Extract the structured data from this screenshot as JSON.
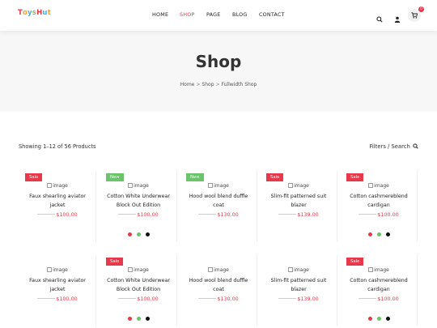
{
  "header": {
    "logo_letters": [
      {
        "ch": "T",
        "color": "#e8394a"
      },
      {
        "ch": "o",
        "color": "#f6a623"
      },
      {
        "ch": "y",
        "color": "#3bb3e8"
      },
      {
        "ch": "s",
        "color": "#8bc34a"
      },
      {
        "ch": "H",
        "color": "#e8394a"
      },
      {
        "ch": "u",
        "color": "#3bb3e8"
      },
      {
        "ch": "t",
        "color": "#f6a623"
      }
    ],
    "nav": [
      "HOME",
      "SHOP",
      "PAGE",
      "BLOG",
      "CONTACT"
    ],
    "active_nav": "SHOP",
    "cart_count": "0"
  },
  "banner": {
    "title": "Shop",
    "breadcrumb": [
      "Home",
      "Shop",
      "Fullwidth Shop"
    ],
    "separator": ">"
  },
  "toolbar": {
    "result_count": "Showing 1–12 of 56 Products",
    "filters_label": "Filters / Search"
  },
  "image_alt": "image",
  "colors": {
    "accent": "#e8394a",
    "new_badge": "#6bc46b"
  },
  "products": [
    {
      "name_lines": [
        "Faux shearling aviator",
        "jacket"
      ],
      "price": "$100.00",
      "badge": "Sale",
      "badge_type": "sale",
      "swatches": []
    },
    {
      "name_lines": [
        "Cotton White Underwear",
        "Block Out Edition"
      ],
      "price": "$100.00",
      "badge": "New",
      "badge_type": "new",
      "swatches": [
        "#e8394a",
        "#6bc46b",
        "#111111"
      ]
    },
    {
      "name_lines": [
        "Hood wool blend duffle",
        "coat"
      ],
      "price": "$130.00",
      "badge": "New",
      "badge_type": "new",
      "swatches": []
    },
    {
      "name_lines": [
        "Slim-fit patterned suit",
        "blazer"
      ],
      "price": "$139.00",
      "badge": "Sale",
      "badge_type": "sale",
      "swatches": []
    },
    {
      "name_lines": [
        "Cotton cashmereblend",
        "cardigan"
      ],
      "price": "$100.00",
      "badge": "Sale",
      "badge_type": "sale",
      "swatches": [
        "#e8394a",
        "#6bc46b",
        "#111111"
      ]
    },
    {
      "name_lines": [
        "Faux shearling aviator",
        "jacket"
      ],
      "price": "$100.00",
      "badge": "",
      "badge_type": "",
      "swatches": []
    },
    {
      "name_lines": [
        "Cotton White Underwear",
        "Block Out Edition"
      ],
      "price": "$100.00",
      "badge": "Sale",
      "badge_type": "sale",
      "swatches": [
        "#e8394a",
        "#6bc46b",
        "#111111"
      ]
    },
    {
      "name_lines": [
        "Hood wool blend duffle",
        "coat"
      ],
      "price": "$130.00",
      "badge": "",
      "badge_type": "",
      "swatches": []
    },
    {
      "name_lines": [
        "Slim-fit patterned suit",
        "blazer"
      ],
      "price": "$139.00",
      "badge": "",
      "badge_type": "",
      "swatches": []
    },
    {
      "name_lines": [
        "Cotton cashmereblend",
        "cardigan"
      ],
      "price": "$100.00",
      "badge": "Sale",
      "badge_type": "sale",
      "swatches": [
        "#e8394a",
        "#6bc46b",
        "#111111"
      ]
    }
  ]
}
